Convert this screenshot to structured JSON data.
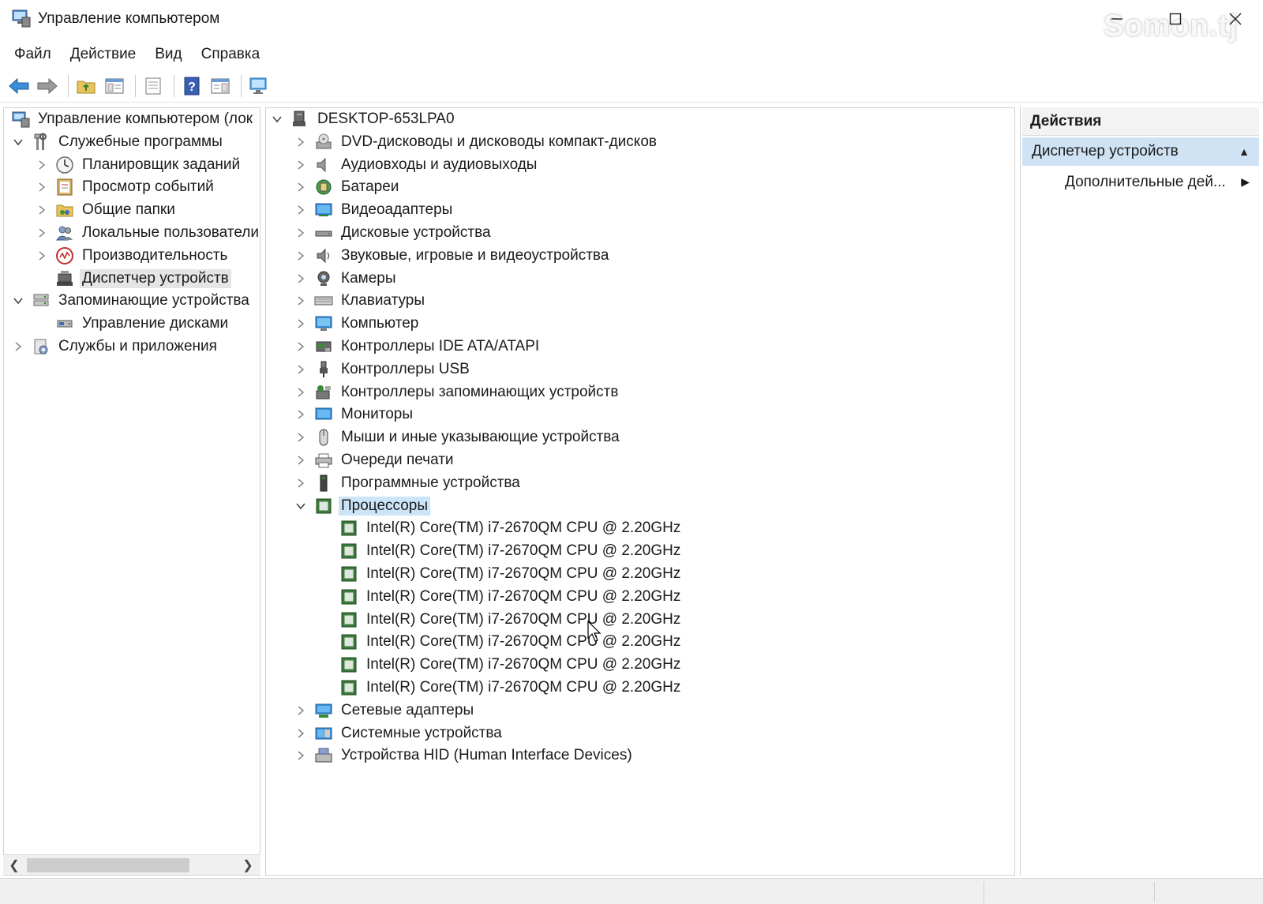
{
  "window": {
    "title": "Управление компьютером",
    "watermark": "Somon.tj"
  },
  "menu": [
    "Файл",
    "Действие",
    "Вид",
    "Справка"
  ],
  "left_tree": [
    {
      "label": "Управление компьютером (лок",
      "icon": "computer-management-icon",
      "level": 0,
      "chevron": "none"
    },
    {
      "label": "Служебные программы",
      "icon": "tools-icon",
      "level": 1,
      "chevron": "expanded"
    },
    {
      "label": "Планировщик заданий",
      "icon": "clock-icon",
      "level": 2,
      "chevron": "collapsed"
    },
    {
      "label": "Просмотр событий",
      "icon": "event-viewer-icon",
      "level": 2,
      "chevron": "collapsed"
    },
    {
      "label": "Общие папки",
      "icon": "shared-folder-icon",
      "level": 2,
      "chevron": "collapsed"
    },
    {
      "label": "Локальные пользователи",
      "icon": "users-icon",
      "level": 2,
      "chevron": "collapsed"
    },
    {
      "label": "Производительность",
      "icon": "performance-icon",
      "level": 2,
      "chevron": "collapsed"
    },
    {
      "label": "Диспетчер устройств",
      "icon": "device-manager-icon",
      "level": 2,
      "chevron": "none",
      "selected": true
    },
    {
      "label": "Запоминающие устройства",
      "icon": "storage-icon",
      "level": 1,
      "chevron": "expanded"
    },
    {
      "label": "Управление дисками",
      "icon": "disk-management-icon",
      "level": 2,
      "chevron": "none"
    },
    {
      "label": "Службы и приложения",
      "icon": "services-icon",
      "level": 1,
      "chevron": "collapsed"
    }
  ],
  "device_tree": {
    "root": "DESKTOP-653LPA0",
    "categories": [
      {
        "label": "DVD-дисководы и дисководы компакт-дисков",
        "icon": "dvd-icon",
        "expanded": false
      },
      {
        "label": "Аудиовходы и аудиовыходы",
        "icon": "speaker-icon",
        "expanded": false
      },
      {
        "label": "Батареи",
        "icon": "battery-icon",
        "expanded": false
      },
      {
        "label": "Видеоадаптеры",
        "icon": "display-adapter-icon",
        "expanded": false
      },
      {
        "label": "Дисковые устройства",
        "icon": "disk-drive-icon",
        "expanded": false
      },
      {
        "label": "Звуковые, игровые и видеоустройства",
        "icon": "sound-icon",
        "expanded": false
      },
      {
        "label": "Камеры",
        "icon": "camera-icon",
        "expanded": false
      },
      {
        "label": "Клавиатуры",
        "icon": "keyboard-icon",
        "expanded": false
      },
      {
        "label": "Компьютер",
        "icon": "computer-icon",
        "expanded": false
      },
      {
        "label": "Контроллеры IDE ATA/ATAPI",
        "icon": "ide-controller-icon",
        "expanded": false
      },
      {
        "label": "Контроллеры USB",
        "icon": "usb-icon",
        "expanded": false
      },
      {
        "label": "Контроллеры запоминающих устройств",
        "icon": "storage-controller-icon",
        "expanded": false
      },
      {
        "label": "Мониторы",
        "icon": "monitor-icon",
        "expanded": false
      },
      {
        "label": "Мыши и иные указывающие устройства",
        "icon": "mouse-icon",
        "expanded": false
      },
      {
        "label": "Очереди печати",
        "icon": "printer-icon",
        "expanded": false
      },
      {
        "label": "Программные устройства",
        "icon": "software-device-icon",
        "expanded": false
      },
      {
        "label": "Процессоры",
        "icon": "processor-icon",
        "expanded": true,
        "selected": true,
        "children": [
          "Intel(R) Core(TM) i7-2670QM CPU @ 2.20GHz",
          "Intel(R) Core(TM) i7-2670QM CPU @ 2.20GHz",
          "Intel(R) Core(TM) i7-2670QM CPU @ 2.20GHz",
          "Intel(R) Core(TM) i7-2670QM CPU @ 2.20GHz",
          "Intel(R) Core(TM) i7-2670QM CPU @ 2.20GHz",
          "Intel(R) Core(TM) i7-2670QM CPU @ 2.20GHz",
          "Intel(R) Core(TM) i7-2670QM CPU @ 2.20GHz",
          "Intel(R) Core(TM) i7-2670QM CPU @ 2.20GHz"
        ]
      },
      {
        "label": "Сетевые адаптеры",
        "icon": "network-adapter-icon",
        "expanded": false
      },
      {
        "label": "Системные устройства",
        "icon": "system-devices-icon",
        "expanded": false
      },
      {
        "label": "Устройства HID (Human Interface Devices)",
        "icon": "hid-icon",
        "expanded": false
      }
    ]
  },
  "actions": {
    "header": "Действия",
    "section": "Диспетчер устройств",
    "more": "Дополнительные дей..."
  },
  "colors": {
    "selection_blue": "#cce4f7",
    "selection_grey": "#e5e5e5",
    "processor_green": "#3d7a3d"
  }
}
